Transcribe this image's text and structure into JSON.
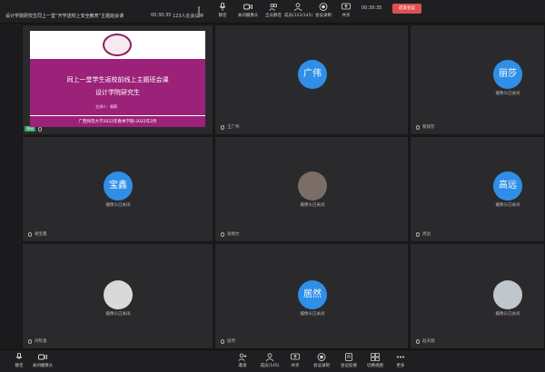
{
  "topbar": {
    "meeting_title": "设计学院研究生同上一堂“开学送校上安全教育”主题班会课",
    "elapsed": "00:30:35",
    "online": "123人在会议中",
    "clock": "00:30:35",
    "end_button": "结束会议",
    "tools": [
      {
        "label": "静音",
        "icon": "mic-icon"
      },
      {
        "label": "关闭摄像头",
        "icon": "camera-icon"
      },
      {
        "label": "全员静音",
        "icon": "mute-all-icon"
      },
      {
        "label": "成员(122/145)",
        "icon": "members-icon"
      },
      {
        "label": "会议录制",
        "icon": "record-icon"
      },
      {
        "label": "共享",
        "icon": "share-icon"
      }
    ]
  },
  "slide": {
    "title": "同上一堂学生返校前线上主题班会课",
    "subtitle": "设计学院研究生",
    "speaker": "主讲人：周莉",
    "footer": "广西师范大学2022年春季学期-2022年2月"
  },
  "participants": [
    {
      "name": "张丽",
      "camera_off": "",
      "avatar_text": ""
    },
    {
      "name": "王广伟",
      "camera_off": "摄像头已关闭",
      "avatar_text": "广伟"
    },
    {
      "name": "蔡丽莎",
      "camera_off": "摄像头已关闭",
      "avatar_text": "丽莎"
    },
    {
      "name": "胡宝鑫",
      "camera_off": "摄像头已关闭",
      "avatar_text": "宝鑫"
    },
    {
      "name": "张佩文",
      "camera_off": "摄像头已关闭",
      "avatar_text": ""
    },
    {
      "name": "周远",
      "camera_off": "摄像头已关闭",
      "avatar_text": "高远"
    },
    {
      "name": "丹陈金",
      "camera_off": "摄像头已关闭",
      "avatar_text": ""
    },
    {
      "name": "居然",
      "camera_off": "摄像头已关闭",
      "avatar_text": "居然"
    },
    {
      "name": "赵天翔",
      "camera_off": "摄像头已关闭",
      "avatar_text": ""
    }
  ],
  "bottombar": {
    "tools": [
      {
        "label": "静音",
        "icon": "mic-icon"
      },
      {
        "label": "关闭摄像头",
        "icon": "camera-icon"
      },
      {
        "label": "邀请",
        "icon": "invite-icon"
      },
      {
        "label": "成员(145)",
        "icon": "members-icon"
      },
      {
        "label": "共享",
        "icon": "share-icon"
      },
      {
        "label": "会议录制",
        "icon": "record-icon"
      },
      {
        "label": "会议纪要",
        "icon": "minutes-icon"
      },
      {
        "label": "切换视图",
        "icon": "view-icon"
      },
      {
        "label": "更多",
        "icon": "more-icon"
      }
    ]
  },
  "colors": {
    "accent_blue": "#2f8fe8",
    "end_red": "#e05050",
    "slide_magenta": "#9c2178"
  }
}
